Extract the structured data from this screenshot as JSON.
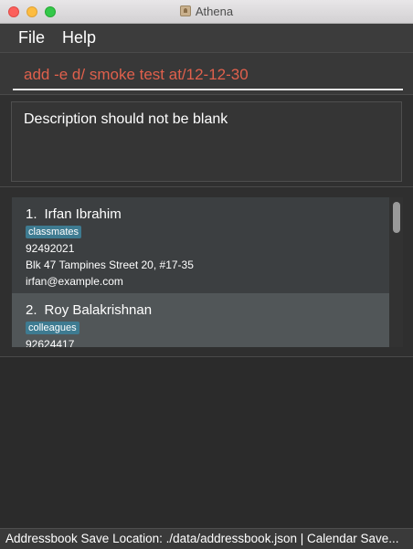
{
  "window": {
    "title": "Athena"
  },
  "menu": {
    "items": [
      "File",
      "Help"
    ]
  },
  "command": {
    "value": "add -e d/ smoke test at/12-12-30"
  },
  "result": {
    "message": "Description should not be blank"
  },
  "contacts": [
    {
      "index": "1.",
      "name": "Irfan Ibrahim",
      "tag": "classmates",
      "phone": "92492021",
      "address": "Blk 47 Tampines Street 20, #17-35",
      "email": "irfan@example.com"
    },
    {
      "index": "2.",
      "name": "Roy Balakrishnan",
      "tag": "colleagues",
      "phone": "92624417"
    }
  ],
  "status": {
    "text": "Addressbook Save Location: ./data/addressbook.json | Calendar Save..."
  },
  "colors": {
    "command_error": "#e0604c",
    "tag_background": "#3e7b91",
    "selected_card": "#515658"
  }
}
